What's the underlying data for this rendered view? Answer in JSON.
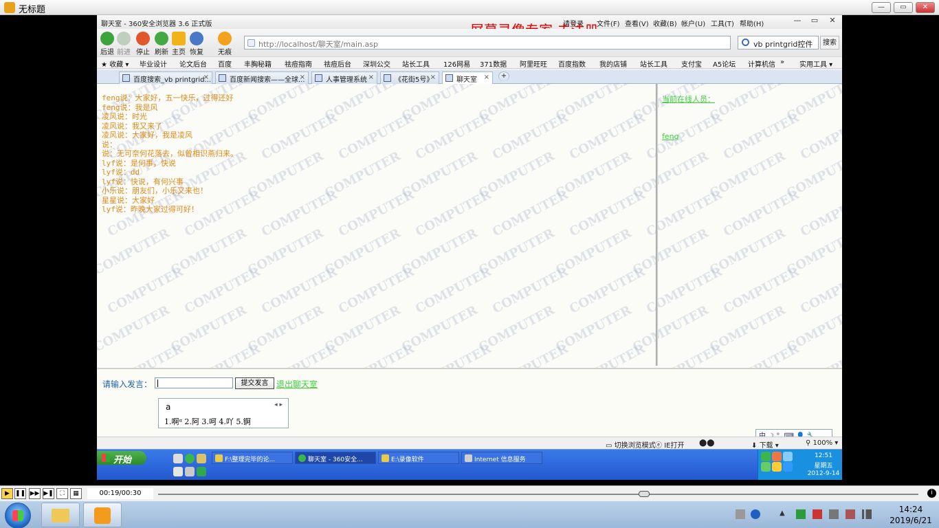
{
  "player": {
    "title": "无标题",
    "time": "00:19/00:30",
    "progress": 0.63
  },
  "browser": {
    "window_title": "聊天室 - 360安全浏览器 3.6 正式版",
    "watermark": "屏幕录像专家 未注册",
    "menus": [
      "请登录",
      "文件(F)",
      "查看(V)",
      "收藏(B)",
      "帐户(U)",
      "工具(T)",
      "帮助(H)"
    ],
    "nav": {
      "back": "后退",
      "forward": "前进",
      "stop": "停止",
      "refresh": "刷新",
      "home": "主页",
      "restore": "恢复",
      "traceless": "无痕"
    },
    "address": "http://localhost/聊天室/main.asp",
    "brand": "360",
    "search_value": "vb printgrid控件",
    "search_button": "搜索",
    "favorites_label": "收藏",
    "favorites": [
      "毕业设计",
      "论文后台",
      "百度",
      "丰胸秘籍",
      "祛痘指南",
      "祛痘后台",
      "深圳公交",
      "站长工具",
      "126网易",
      "371数据",
      "阿里旺旺",
      "百度指数",
      "我的店铺",
      "站长工具",
      "支付宝",
      "A5论坛",
      "计算机信"
    ],
    "favorites_more": "»",
    "tools_label": "实用工具",
    "tabs": [
      {
        "label": "百度搜索_vb printgrid..."
      },
      {
        "label": "百度新闻搜索——全球..."
      },
      {
        "label": "人事管理系统"
      },
      {
        "label": "《花街5号》"
      },
      {
        "label": "聊天室"
      }
    ],
    "status": {
      "mode": "切换浏览模式",
      "ie": "IE打开",
      "download": "下载",
      "zoom": "100%"
    }
  },
  "chat": {
    "messages": [
      "feng说：大家好，五一快乐，过得还好",
      "feng说：我是风",
      "凌风说：时光",
      "凌风说：我又来了",
      "凌风说：大家好，我是凌风",
      "说：",
      "说：无可奈何花落去，似曾相识燕归来。",
      "lyf说：是何事，快说",
      "lyf说：dd",
      "lyf说：快说，有何兴事",
      "小乐说：朋友们，小乐又来也！",
      "星星说：大家好",
      "lyf说：昨晚大家过得可好！"
    ],
    "online_title": "当前在线人员：",
    "online_users": [
      "feng"
    ],
    "prompt_label": "请输入发言：",
    "input_value": "",
    "submit_label": "提交发言",
    "leave_label": "退出聊天室",
    "bg_watermark": "COMPUTER"
  },
  "ime": {
    "composition": "a",
    "candidates": "1.啊ᵅ 2.阿 3.呵 4.吖 5.锕",
    "toolbar": "中 ☽ °, ⌨ 👤 🔧"
  },
  "inner_taskbar": {
    "start_label": "开始",
    "tasks": [
      "F:\\整理完毕的论...",
      "聊天室 - 360安全...",
      "E:\\录像软件",
      "Internet 信息服务"
    ],
    "time": "12:51",
    "weekday": "星期五",
    "date": "2012-9-14"
  },
  "taskbar": {
    "time": "14:24",
    "date": "2019/6/21"
  }
}
